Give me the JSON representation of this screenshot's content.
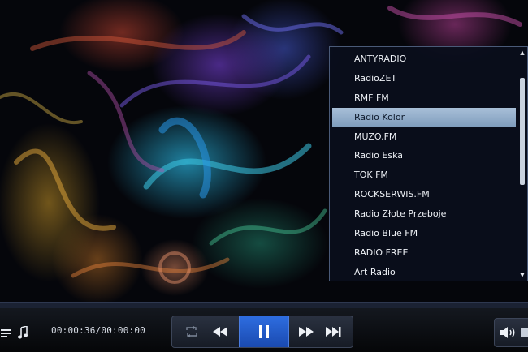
{
  "player": {
    "time_display": "00:00:36/00:00:00",
    "progress": 0
  },
  "playlist": {
    "items": [
      "ANTYRADIO",
      "RadioZET",
      "RMF FM",
      "Radio Kolor",
      "MUZO.FM",
      "Radio Eska",
      "TOK FM",
      "ROCKSERWIS.FM",
      "Radio Złote Przeboje",
      "Radio Blue FM",
      "RADIO FREE",
      "Art Radio"
    ],
    "selected": "Radio Kolor"
  },
  "icons": {
    "scroll_up": "▲",
    "scroll_down": "▼"
  },
  "colors": {
    "accent": "#2e6de0",
    "selection": "#a8bfd8"
  }
}
